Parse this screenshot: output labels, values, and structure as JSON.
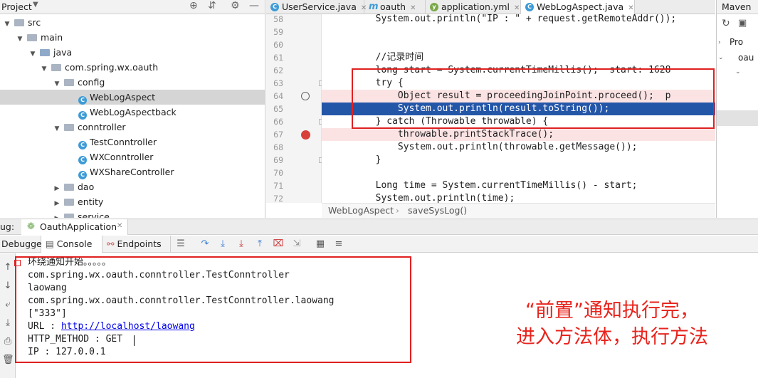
{
  "project_panel": {
    "title": "Project",
    "tree": [
      {
        "label": "src",
        "indent": 0,
        "arrow": "▼",
        "type": "folder",
        "level": 0
      },
      {
        "label": "main",
        "arrow": "▼",
        "type": "folder",
        "level": 1
      },
      {
        "label": "java",
        "arrow": "▼",
        "type": "folder-src",
        "level": 2
      },
      {
        "label": "com.spring.wx.oauth",
        "arrow": "▼",
        "type": "package",
        "level": 3
      },
      {
        "label": "config",
        "arrow": "▼",
        "type": "package",
        "level": 4
      },
      {
        "label": "WebLogAspect",
        "arrow": "",
        "type": "class",
        "level": 5,
        "selected": true
      },
      {
        "label": "WebLogAspectback",
        "arrow": "",
        "type": "class",
        "level": 5
      },
      {
        "label": "conntroller",
        "arrow": "▼",
        "type": "package",
        "level": 4
      },
      {
        "label": "TestConntroller",
        "arrow": "",
        "type": "class",
        "level": 5
      },
      {
        "label": "WXConntroller",
        "arrow": "",
        "type": "class",
        "level": 5
      },
      {
        "label": "WXShareController",
        "arrow": "",
        "type": "class",
        "level": 5
      },
      {
        "label": "dao",
        "arrow": "▶",
        "type": "package",
        "level": 4
      },
      {
        "label": "entity",
        "arrow": "▶",
        "type": "package",
        "level": 4
      },
      {
        "label": "service",
        "arrow": "▶",
        "type": "package",
        "level": 4
      }
    ]
  },
  "editor_tabs": [
    {
      "label": "UserService.java",
      "icon": "C"
    },
    {
      "label": "oauth",
      "icon": "m"
    },
    {
      "label": "application.yml",
      "icon": "y"
    },
    {
      "label": "WebLogAspect.java",
      "icon": "C",
      "active": true
    }
  ],
  "maven_panel": {
    "title": "Maven",
    "items": [
      "Pro",
      "oau"
    ]
  },
  "editor": {
    "line_numbers": [
      "58",
      "59",
      "60",
      "61",
      "62",
      "63",
      "64",
      "65",
      "66",
      "67",
      "68",
      "69",
      "70",
      "71",
      "72"
    ],
    "lines": [
      "        System.out.println(\"IP : \" + request.getRemoteAddr());",
      "",
      "",
      "        //记录时间",
      "        long start = System.currentTimeMillis();  start: 1628",
      "        try {",
      "            Object result = proceedingJoinPoint.proceed();  p",
      "            System.out.println(result.toString());",
      "        } catch (Throwable throwable) {",
      "            throwable.printStackTrace();",
      "            System.out.println(throwable.getMessage());",
      "        }",
      "",
      "        Long time = System.currentTimeMillis() - start;",
      "        System.out.println(time);"
    ],
    "breadcrumb": [
      "WebLogAspect",
      "saveSysLog()"
    ]
  },
  "debug": {
    "label": "ug:",
    "run_config": "OauthApplication",
    "tabs": [
      "Debugger",
      "Console",
      "Endpoints"
    ],
    "console_lines": [
      "环绕通知开始。。。。。",
      "com.spring.wx.oauth.conntroller.TestConntroller",
      "laowang",
      "com.spring.wx.oauth.conntroller.TestConntroller.laowang",
      "[\"333\"]",
      "URL : ",
      "HTTP_METHOD : GET",
      "IP : 127.0.0.1"
    ],
    "url_link": "http://localhost/laowang"
  },
  "annotation": {
    "line1": "“前置”通知执行完，",
    "line2": "进入方法体，执行方法"
  },
  "colors": {
    "highlight": "#2456a8",
    "annotation": "#e02020"
  }
}
